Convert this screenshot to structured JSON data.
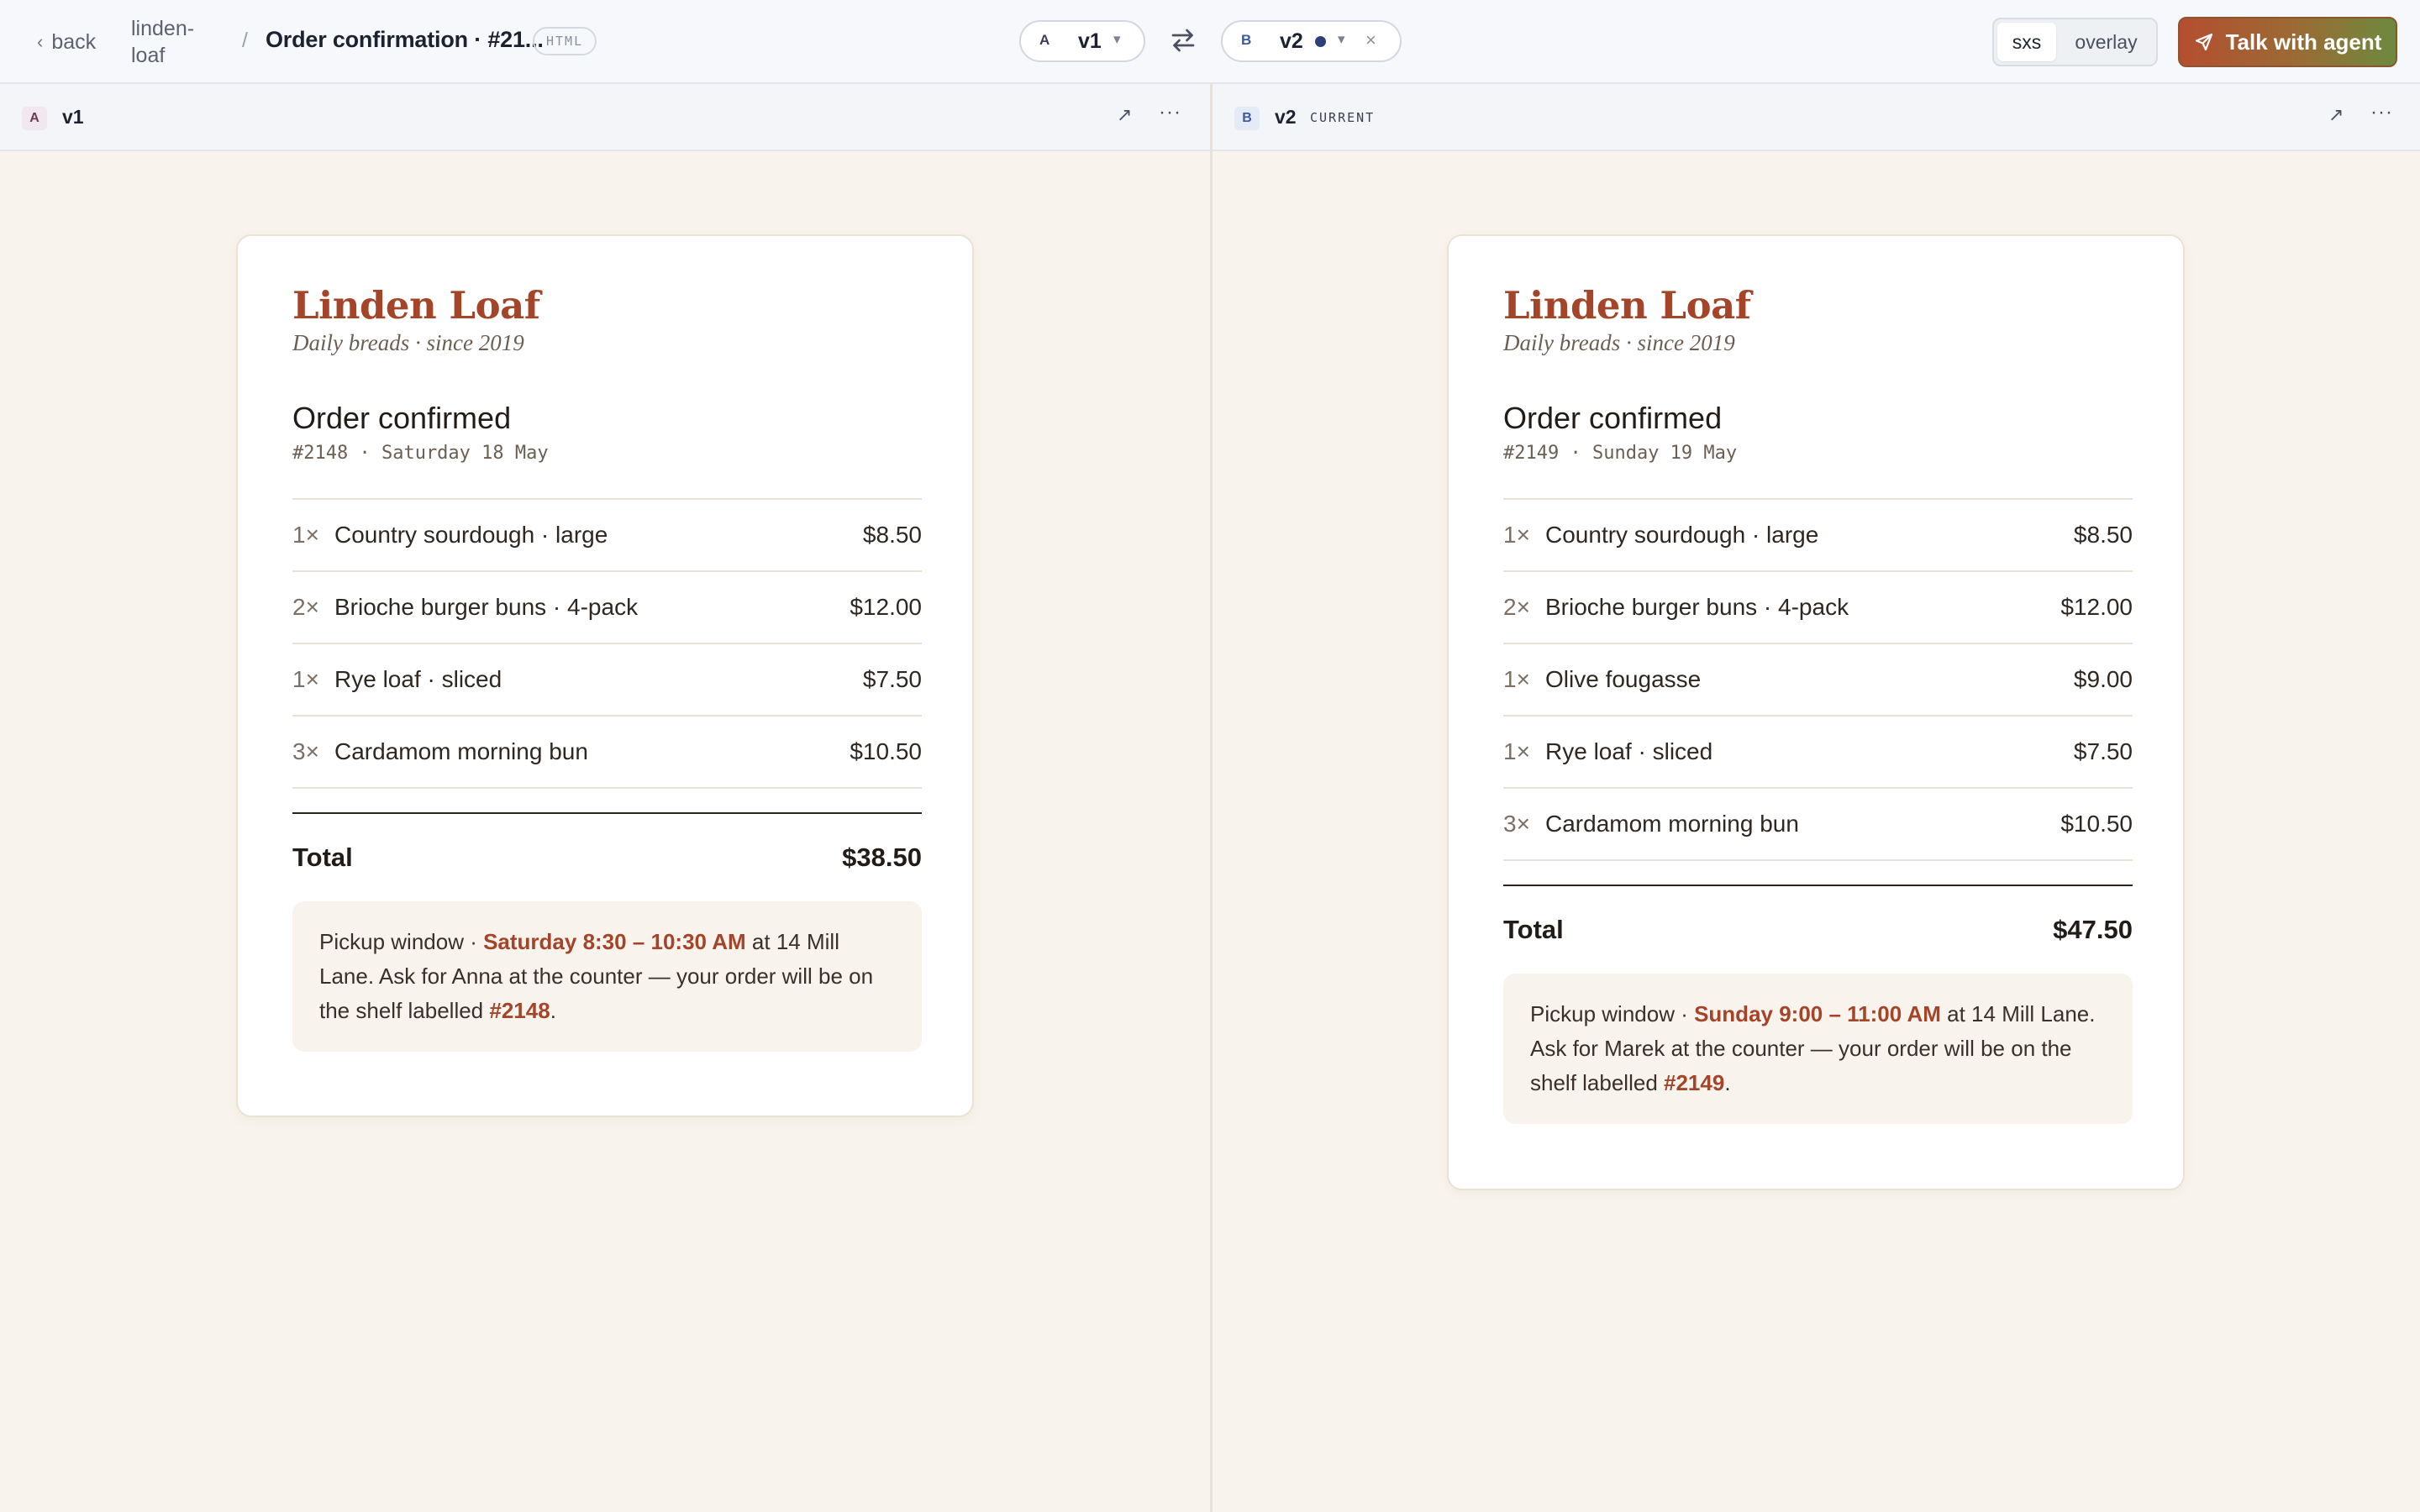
{
  "topbar": {
    "back_label": "back",
    "project": "linden-loaf",
    "title": "Order confirmation · #21...",
    "format_badge": "HTML",
    "version_a": {
      "letter": "A",
      "name": "v1"
    },
    "version_b": {
      "letter": "B",
      "name": "v2"
    },
    "view_modes": [
      "sxs",
      "overlay"
    ],
    "active_view_mode": "sxs",
    "agent_button": "Talk with agent"
  },
  "panes": [
    {
      "badge": "A",
      "label": "v1",
      "current_tag": "",
      "receipt": {
        "brand": "Linden Loaf",
        "tagline": "Daily breads · since 2019",
        "heading": "Order confirmed",
        "meta": "#2148 · Saturday 18 May",
        "items": [
          {
            "qty": "1×",
            "name": "Country sourdough · large",
            "price": "$8.50"
          },
          {
            "qty": "2×",
            "name": "Brioche burger buns · 4-pack",
            "price": "$12.00"
          },
          {
            "qty": "1×",
            "name": "Rye loaf · sliced",
            "price": "$7.50"
          },
          {
            "qty": "3×",
            "name": "Cardamom morning bun",
            "price": "$10.50"
          }
        ],
        "total_label": "Total",
        "total_value": "$38.50",
        "pickup": {
          "prefix": "Pickup window · ",
          "window": "Saturday 8:30 – 10:30 AM",
          "middle": " at 14 Mill Lane. Ask for Anna at the counter — your order will be on the shelf labelled ",
          "shelf": "#2148",
          "suffix": "."
        }
      }
    },
    {
      "badge": "B",
      "label": "v2",
      "current_tag": "CURRENT",
      "receipt": {
        "brand": "Linden Loaf",
        "tagline": "Daily breads · since 2019",
        "heading": "Order confirmed",
        "meta": "#2149 · Sunday 19 May",
        "items": [
          {
            "qty": "1×",
            "name": "Country sourdough · large",
            "price": "$8.50"
          },
          {
            "qty": "2×",
            "name": "Brioche burger buns · 4-pack",
            "price": "$12.00"
          },
          {
            "qty": "1×",
            "name": "Olive fougasse",
            "price": "$9.00"
          },
          {
            "qty": "1×",
            "name": "Rye loaf · sliced",
            "price": "$7.50"
          },
          {
            "qty": "3×",
            "name": "Cardamom morning bun",
            "price": "$10.50"
          }
        ],
        "total_label": "Total",
        "total_value": "$47.50",
        "pickup": {
          "prefix": "Pickup window · ",
          "window": "Sunday 9:00 – 11:00 AM",
          "middle": " at 14 Mill Lane. Ask for Marek at the counter — your order will be on the shelf labelled ",
          "shelf": "#2149",
          "suffix": "."
        }
      }
    }
  ],
  "icons": {
    "back": "chevron-left-icon",
    "swap": "swap-arrows-icon",
    "send": "send-icon",
    "expand": "expand-icon",
    "more": "more-icon",
    "close": "close-icon",
    "caret": "chevron-down-icon"
  },
  "colors": {
    "brand": "#a4452a",
    "page_bg": "#f8f4ed",
    "agent_gradient_start": "#b54e2f",
    "agent_gradient_end": "#6d8a3e",
    "version_b_dot": "#2d3f7a"
  }
}
